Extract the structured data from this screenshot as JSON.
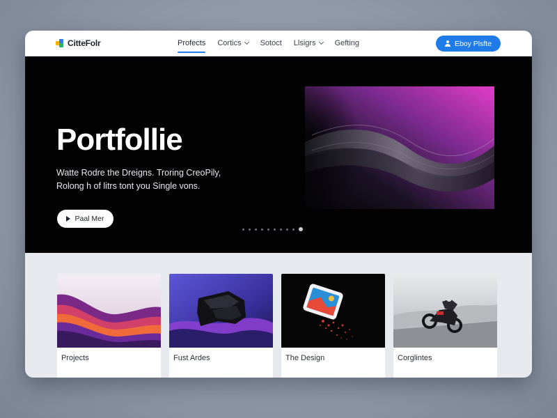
{
  "brand": {
    "name": "CitteFolr",
    "colors": {
      "accent": "#1e7be8",
      "hero_bg": "#020203",
      "magenta": "#e13cc8"
    }
  },
  "nav": {
    "items": [
      {
        "label": "Profects",
        "active": true,
        "dropdown": false
      },
      {
        "label": "Cortics",
        "active": false,
        "dropdown": true
      },
      {
        "label": "Sotoct",
        "active": false,
        "dropdown": false
      },
      {
        "label": "Llsigrs",
        "active": false,
        "dropdown": true
      },
      {
        "label": "Gefting",
        "active": false,
        "dropdown": false
      }
    ],
    "cta_label": "Eboy Plsfte",
    "cta_icon": "user-icon"
  },
  "hero": {
    "title": "Portfollie",
    "subtitle_line1": "Watte Rodre the Dreigns. Troring CreoPily,",
    "subtitle_line2": "Rolong h of litrs tont you Single vons.",
    "button_label": "Paal Mer",
    "button_icon": "play-icon",
    "carousel": {
      "count": 10,
      "active_index": 9
    }
  },
  "cards": [
    {
      "label": "Projects",
      "image": "purple-waves-image"
    },
    {
      "label": "Fust Ardes",
      "image": "dark-fabric-image"
    },
    {
      "label": "The Design",
      "image": "exploding-photo-image"
    },
    {
      "label": "Corglintes",
      "image": "motorcycle-image"
    }
  ]
}
